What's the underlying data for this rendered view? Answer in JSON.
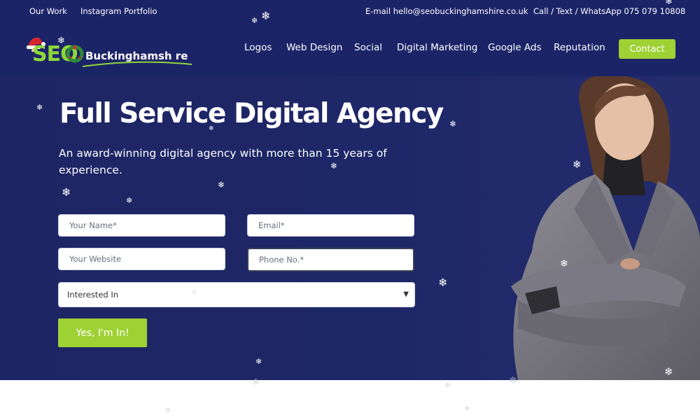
{
  "topbar": {
    "links": [
      "Our Work",
      "Instagram Portfolio"
    ],
    "email": "E-mail hello@seobuckinghamshire.co.uk",
    "phone": "Call / Text / WhatsApp 075 079 10808"
  },
  "brand": {
    "logo_seo": "SEO",
    "logo_county": "Buckinghamsh re"
  },
  "nav": {
    "items": [
      "Logos",
      "Web Design",
      "Social",
      "Digital Marketing",
      "Google Ads",
      "Reputation"
    ],
    "contact": "Contact"
  },
  "hero": {
    "title": "Full Service Digital Agency",
    "subtitle": "An award-winning digital agency with more than 15 years of experience."
  },
  "form": {
    "name_placeholder": "Your Name*",
    "email_placeholder": "Email*",
    "website_placeholder": "Your Website",
    "phone_placeholder": "Phone No.*",
    "interest_selected": "Interested In",
    "submit_label": "Yes, I'm In!"
  },
  "icons": {
    "snowflake": "snowflake-icon",
    "select_arrow": "chevron-down-icon",
    "santa": "santa-hat-icon",
    "wreath": "wreath-icon"
  },
  "colors": {
    "brand_navy": "#1c2468",
    "accent_green": "#9ed134",
    "logo_green": "#8dd63a"
  }
}
